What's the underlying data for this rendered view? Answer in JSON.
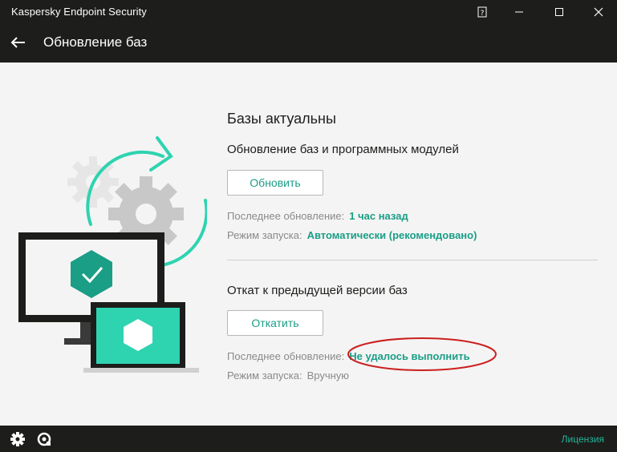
{
  "window": {
    "title": "Kaspersky Endpoint Security",
    "controls": {
      "help": "?",
      "minimize": "—",
      "maximize": "☐",
      "close": "✕"
    }
  },
  "header": {
    "back_icon": "arrow-left-icon",
    "title": "Обновление баз"
  },
  "main": {
    "status": "Базы актуальны",
    "update_section": {
      "title": "Обновление баз и программных модулей",
      "button_label": "Обновить",
      "last_update_label": "Последнее обновление:",
      "last_update_value": "1 час назад",
      "run_mode_label": "Режим запуска:",
      "run_mode_value": "Автоматически (рекомендовано)"
    },
    "rollback_section": {
      "title": "Откат к предыдущей версии баз",
      "button_label": "Откатить",
      "last_update_label": "Последнее обновление:",
      "last_update_value": "Не удалось выполнить",
      "run_mode_label": "Режим запуска:",
      "run_mode_value": "Вручную"
    }
  },
  "footer": {
    "settings_icon": "gear-icon",
    "support_icon": "support-icon",
    "license_label": "Лицензия"
  },
  "colors": {
    "accent": "#1a9e86",
    "accent_light": "#2ed3b0",
    "dark_bar": "#1d1d1b",
    "annotation": "#cc1f1f"
  }
}
